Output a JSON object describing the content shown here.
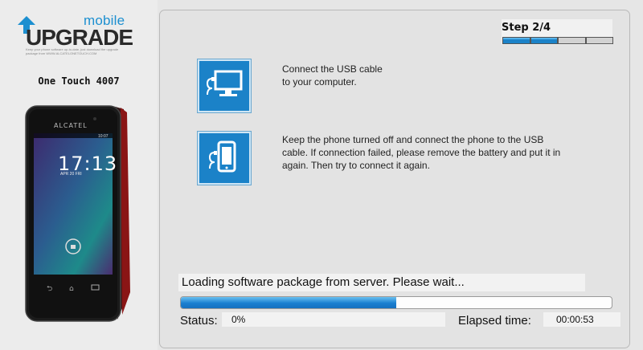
{
  "brand": {
    "logo_mobile": "mobile",
    "logo_upgrade": "UPGRADE",
    "tagline": "Keep your phone software up-to-date, just download the upgrade package from WWW.ALCATELONETOUCH.COM"
  },
  "device": {
    "model_name": "One Touch 4007",
    "phone_brand": "ALCATEL",
    "lock_time": "17:13",
    "lock_date": "APR 20 FRI",
    "status_time": "10:07"
  },
  "stepper": {
    "label": "Step 2/4",
    "current": 2,
    "total": 4
  },
  "instructions": [
    {
      "icon": "usb-monitor-icon",
      "text": "Connect the USB cable\nto your computer."
    },
    {
      "icon": "usb-phone-icon",
      "text": "Keep the phone turned off and connect the phone to the USB\ncable. If connection failed, please remove the battery and put it in\nagain. Then try to connect it again."
    }
  ],
  "loading": {
    "message": "Loading software package from server. Please wait...",
    "progress_fraction": 0.5
  },
  "status": {
    "label": "Status:",
    "value": "0%"
  },
  "elapsed": {
    "label": "Elapsed time:",
    "value": "00:00:53"
  },
  "colors": {
    "accent": "#1b82c8",
    "panel": "#e3e3e3",
    "phone_frame": "#8a1515"
  }
}
